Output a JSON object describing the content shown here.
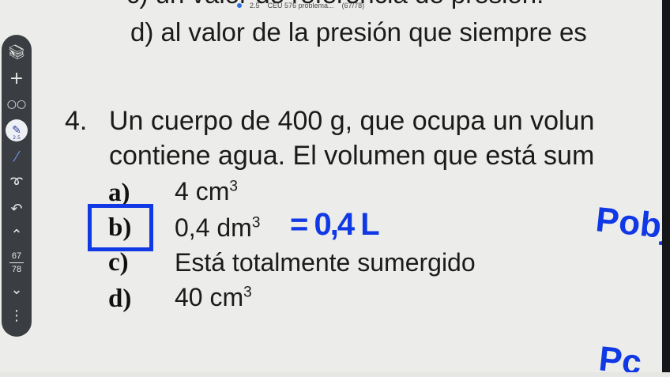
{
  "header": {
    "pen_size": "2.5",
    "doc_title": "CEU 576 problema...",
    "doc_pages": "(67/78)"
  },
  "previous_question": {
    "cut_line": "c) un valor de referencia de presión.",
    "line_d": "d) al valor de la presión que siempre es"
  },
  "question": {
    "number": "4.",
    "line1": "Un cuerpo de 400 g, que ocupa un volun",
    "line2": "contiene agua. El volumen que está sum",
    "options": [
      {
        "letter": "a)",
        "text": "4 cm",
        "sup": "3"
      },
      {
        "letter": "b)",
        "text": "0,4 dm",
        "sup": "3"
      },
      {
        "letter": "c)",
        "text": "Está totalmente sumergido",
        "sup": ""
      },
      {
        "letter": "d)",
        "text": "40 cm",
        "sup": "3"
      }
    ]
  },
  "annotations": {
    "equals_note": "= 0,4 L",
    "p_obj": "Pobj",
    "p_cut": "Pc"
  },
  "toolbar": {
    "items": [
      "library-icon",
      "add-icon",
      "glasses-icon",
      "pen-icon",
      "highlighter-icon",
      "lasso-icon",
      "undo-icon",
      "page-up-icon",
      "page-down-icon",
      "more-icon"
    ],
    "pen_size": "2.5",
    "page_current": "67",
    "page_total": "78",
    "more_label": "⋮"
  },
  "colors": {
    "annotation_blue": "#1038e5",
    "toolbar_bg": "#3a3d42",
    "page_bg": "#ecedea"
  }
}
